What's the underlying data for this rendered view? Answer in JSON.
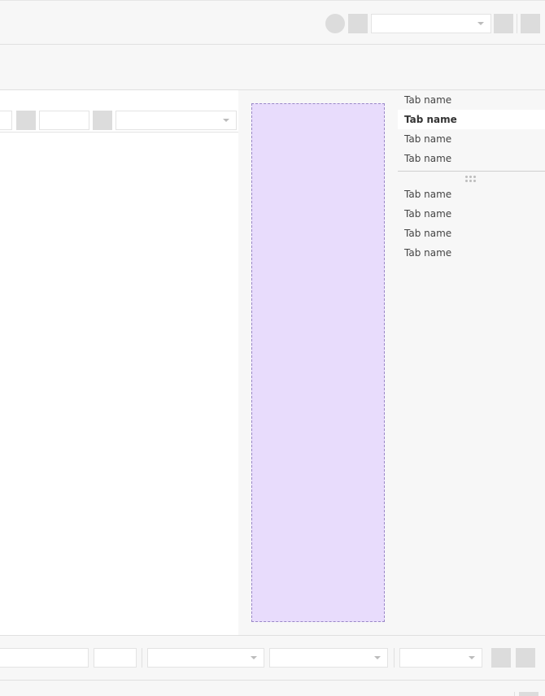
{
  "header": {
    "view_select_value": ""
  },
  "canvas_toolbar": {
    "field_a_value": "",
    "field_b_value": "",
    "select_value": ""
  },
  "tabs": {
    "group_one": [
      {
        "label": "Tab name",
        "active": false
      },
      {
        "label": "Tab name",
        "active": true
      },
      {
        "label": "Tab name",
        "active": false
      },
      {
        "label": "Tab name",
        "active": false
      }
    ],
    "group_two": [
      {
        "label": "Tab name",
        "active": false
      },
      {
        "label": "Tab name",
        "active": false
      },
      {
        "label": "Tab name",
        "active": false
      },
      {
        "label": "Tab name",
        "active": false
      }
    ]
  },
  "bottom_toolbar": {
    "text_field_value": "",
    "small_field_value": "",
    "select_1_value": "",
    "select_2_value": "",
    "select_3_value": ""
  },
  "colors": {
    "placeholder_fill": "#e8dcfc",
    "placeholder_border": "#9a88c8",
    "control_gray": "#dcdcdc",
    "background": "#f7f7f7"
  }
}
